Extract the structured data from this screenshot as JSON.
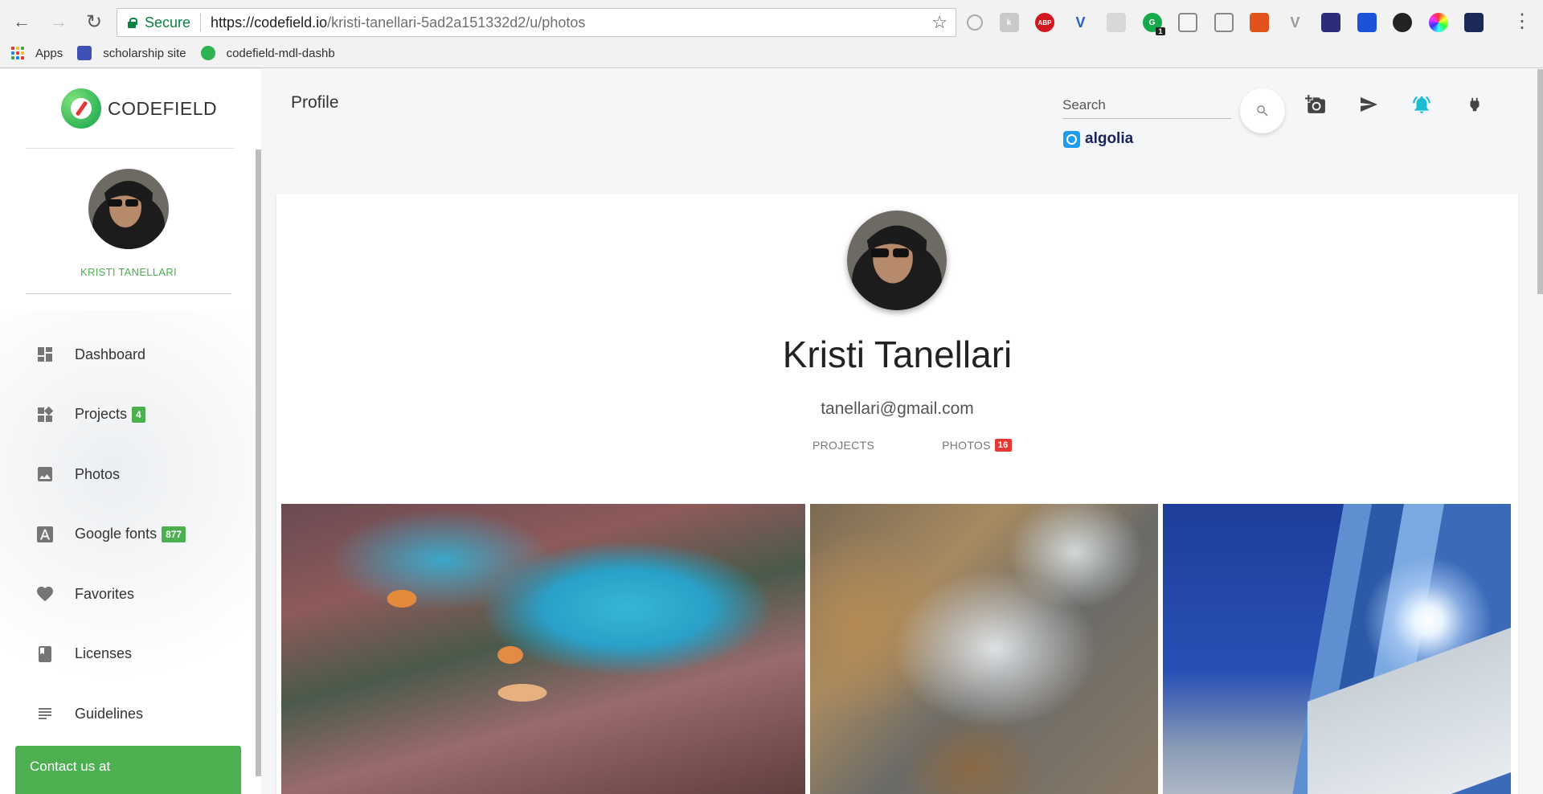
{
  "browser": {
    "secure_label": "Secure",
    "url_host": "https://codefield.io",
    "url_path": "/kristi-tanellari-5ad2a151332d2/u/photos",
    "extension_badge": "1",
    "extensions": [
      "ext-circle-icon",
      "ext-k-icon",
      "abp-icon",
      "vuejs-devtools-icon",
      "camera-ext-icon",
      "grammarly-icon",
      "table-ext-icon",
      "screen-ext-icon",
      "office-ext-icon",
      "vee-ext-icon",
      "colorzilla-icon",
      "ext-blue-icon",
      "ext-flame-icon",
      "color-wheel-icon",
      "ext-dark-icon"
    ],
    "bookmarks": [
      {
        "label": "Apps"
      },
      {
        "label": "scholarship site"
      },
      {
        "label": "codefield-mdl-dashb"
      }
    ]
  },
  "sidebar": {
    "brand": "CODEFIELD",
    "username": "KRISTI TANELLARI",
    "items": [
      {
        "label": "Dashboard",
        "icon": "dashboard-icon",
        "badge": ""
      },
      {
        "label": "Projects",
        "icon": "projects-icon",
        "badge": "4"
      },
      {
        "label": "Photos",
        "icon": "photo-icon",
        "badge": ""
      },
      {
        "label": "Google fonts",
        "icon": "font-icon",
        "badge": "877"
      },
      {
        "label": "Favorites",
        "icon": "heart-icon",
        "badge": ""
      },
      {
        "label": "Licenses",
        "icon": "book-icon",
        "badge": ""
      },
      {
        "label": "Guidelines",
        "icon": "lines-icon",
        "badge": ""
      }
    ],
    "contact_label": "Contact us at"
  },
  "header": {
    "title": "Profile",
    "search_placeholder": "Search",
    "algolia": "algolia"
  },
  "profile": {
    "name": "Kristi Tanellari",
    "email": "tanellari@gmail.com",
    "tabs": [
      {
        "label": "PROJECTS",
        "badge": ""
      },
      {
        "label": "PHOTOS",
        "badge": "16"
      }
    ]
  },
  "colors": {
    "accent_green": "#4caf50",
    "badge_red": "#e53935",
    "notification_teal": "#19bcd0"
  }
}
